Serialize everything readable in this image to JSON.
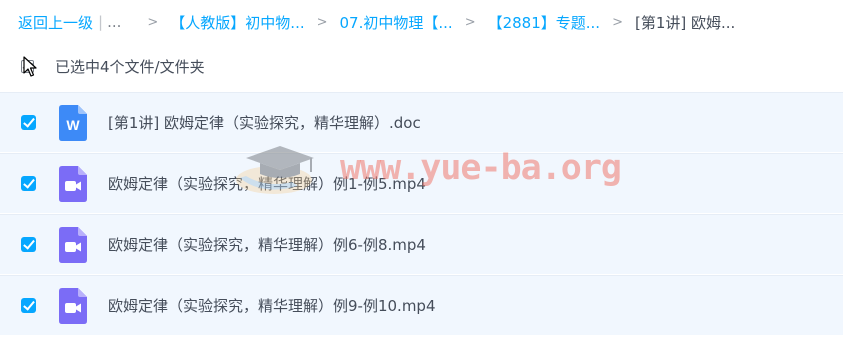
{
  "breadcrumb": {
    "back_label": "返回上一级",
    "ellipsis": "...",
    "separator": ">",
    "items": [
      "【人教版】初中物...",
      "07.初中物理【...",
      "【2881】专题...",
      "[第1讲] 欧姆..."
    ]
  },
  "selection": {
    "summary": "已选中4个文件/文件夹"
  },
  "files": [
    {
      "name": "[第1讲] 欧姆定律（实验探究，精华理解）.doc",
      "type": "word-doc-icon",
      "checked": true
    },
    {
      "name": "欧姆定律（实验探究，精华理解）例1-例5.mp4",
      "type": "video-file-icon",
      "checked": true
    },
    {
      "name": "欧姆定律（实验探究，精华理解）例6-例8.mp4",
      "type": "video-file-icon",
      "checked": true
    },
    {
      "name": "欧姆定律（实验探究，精华理解）例9-例10.mp4",
      "type": "video-file-icon",
      "checked": true
    }
  ],
  "watermark": {
    "text": "www.yue-ba.org"
  },
  "colors": {
    "accent": "#06a7ff",
    "row_selected_bg": "#f1f7fe",
    "text": "#454d5a",
    "word_icon": "#3d8af7",
    "video_icon": "#7b6cf6",
    "watermark": "#f06e5f"
  }
}
